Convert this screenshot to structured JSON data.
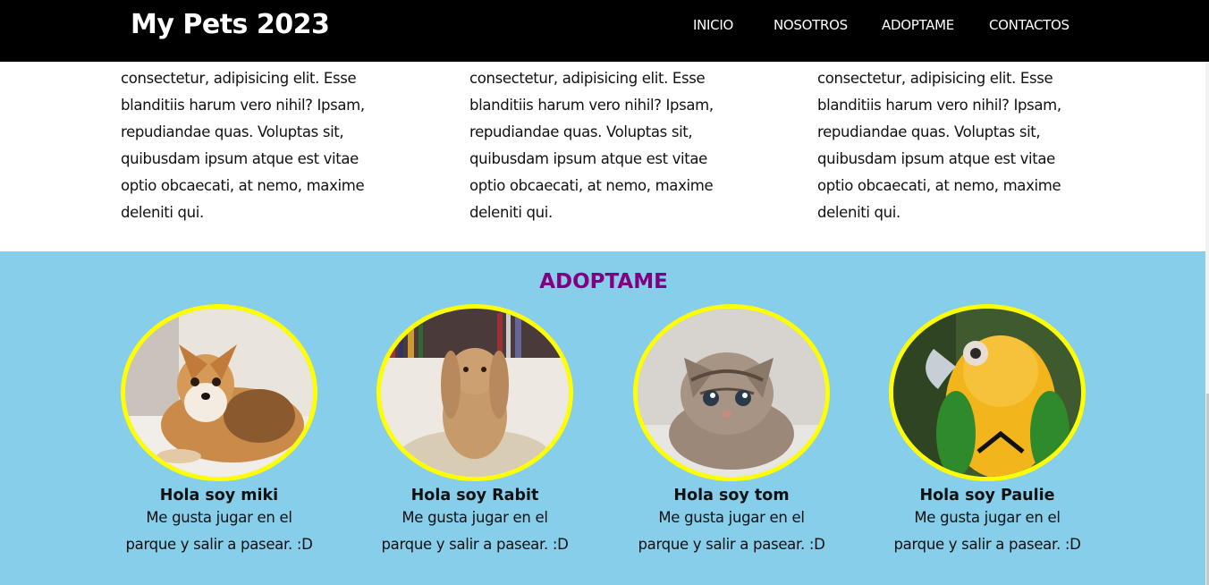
{
  "navbar": {
    "brand": "My Pets 2023",
    "links": [
      "INICIO",
      "NOSOTROS",
      "ADOPTAME",
      "CONTACTOS"
    ]
  },
  "columns": [
    {
      "lines": [
        "consectetur, adipisicing elit. Esse",
        "blanditiis harum vero nihil? Ipsam,",
        "repudiandae quas. Voluptas sit,",
        "quibusdam ipsum atque est vitae",
        "optio obcaecati, at nemo, maxime",
        "deleniti qui."
      ]
    },
    {
      "lines": [
        "consectetur, adipisicing elit. Esse",
        "blanditiis harum vero nihil? Ipsam,",
        "repudiandae quas. Voluptas sit,",
        "quibusdam ipsum atque est vitae",
        "optio obcaecati, at nemo, maxime",
        "deleniti qui."
      ]
    },
    {
      "lines": [
        "consectetur, adipisicing elit. Esse",
        "blanditiis harum vero nihil? Ipsam,",
        "repudiandae quas. Voluptas sit,",
        "quibusdam ipsum atque est vitae",
        "optio obcaecati, at nemo, maxime",
        "deleniti qui."
      ]
    }
  ],
  "adopt": {
    "title": "ADOPTAME",
    "pets": [
      {
        "name": "Hola soy miki",
        "desc_lines": [
          "Me gusta jugar en el",
          "parque y salir a pasear. :D"
        ],
        "photo": "dog-photo"
      },
      {
        "name": "Hola soy Rabit",
        "desc_lines": [
          "Me gusta jugar en el",
          "parque y salir a pasear. :D"
        ],
        "photo": "rabbit-photo"
      },
      {
        "name": "Hola soy tom",
        "desc_lines": [
          "Me gusta jugar en el",
          "parque y salir a pasear. :D"
        ],
        "photo": "kitten-photo"
      },
      {
        "name": "Hola soy Paulie",
        "desc_lines": [
          "Me gusta jugar en el",
          "parque y salir a pasear. :D"
        ],
        "photo": "parrot-photo"
      }
    ]
  },
  "colors": {
    "navbar_bg": "#000000",
    "adopt_bg": "#87ceeb",
    "title_color": "#800080",
    "photo_border": "#ffff00"
  }
}
